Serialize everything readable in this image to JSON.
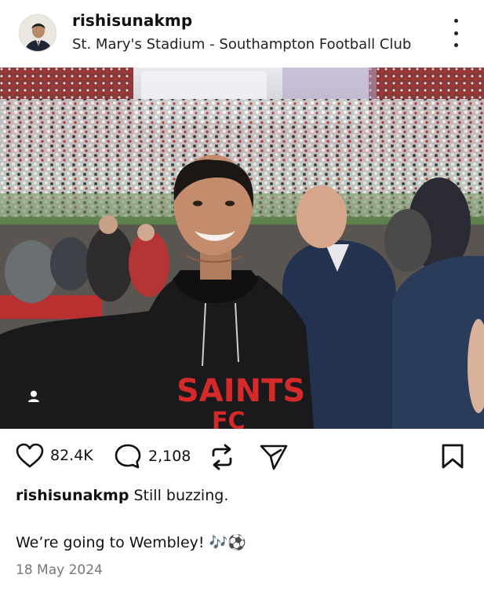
{
  "post": {
    "username": "rishisunakmp",
    "location": "St. Mary's Stadium - Southampton Football Club",
    "shirt_text": "SAINTS",
    "shirt_text2": "FC"
  },
  "actions": {
    "likes": "82.4K",
    "comments": "2,108"
  },
  "caption": {
    "username": "rishisunakmp",
    "text": "Still buzzing.",
    "line2": "We’re going to Wembley! 🎶⚽"
  },
  "date": "18 May 2024",
  "icons": {
    "more": "more-vertical-icon",
    "like": "heart-icon",
    "comment": "comment-icon",
    "repost": "repost-icon",
    "share": "send-icon",
    "save": "bookmark-icon",
    "tag": "user-tag-icon"
  },
  "colors": {
    "text": "#111111",
    "muted": "#777777",
    "shirt_text": "#d42a2a"
  }
}
